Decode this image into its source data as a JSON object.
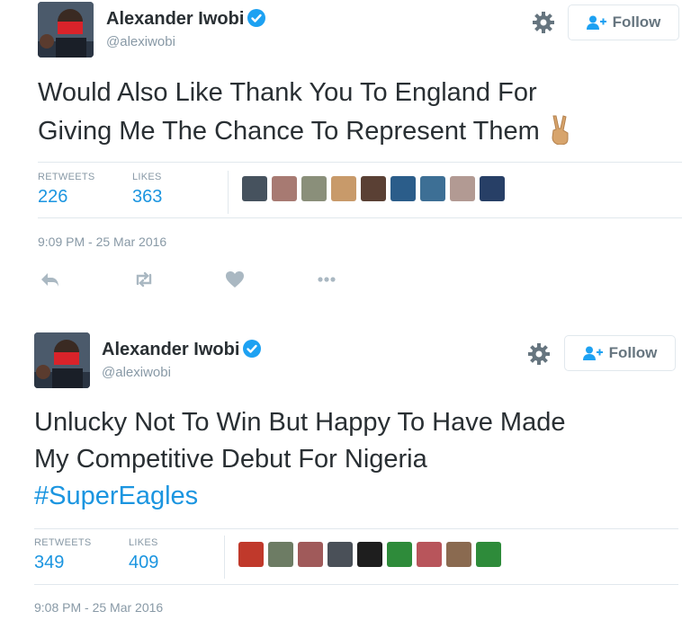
{
  "tweets": [
    {
      "name": "Alexander Iwobi",
      "handle": "@alexiwobi",
      "follow_label": "Follow",
      "text_lines": [
        "Would Also Like Thank You To England For",
        "Giving Me The Chance To Represent Them"
      ],
      "emoji": "victory-hand",
      "retweets_label": "RETWEETS",
      "retweets": "226",
      "likes_label": "LIKES",
      "likes": "363",
      "timestamp": "9:09 PM - 25 Mar 2016",
      "liker_colors": [
        "#46525e",
        "#a77a72",
        "#8a8f7a",
        "#c89a6a",
        "#5a4034",
        "#2b5d8a",
        "#3d6f95",
        "#b29a93",
        "#273f66"
      ]
    },
    {
      "name": "Alexander Iwobi",
      "handle": "@alexiwobi",
      "follow_label": "Follow",
      "text_lines": [
        "Unlucky Not To Win But Happy To Have Made",
        "My Competitive Debut For Nigeria"
      ],
      "hashtag": "#SuperEagles",
      "retweets_label": "RETWEETS",
      "retweets": "349",
      "likes_label": "LIKES",
      "likes": "409",
      "timestamp": "9:08 PM - 25 Mar 2016",
      "liker_colors": [
        "#c0392b",
        "#6d7c64",
        "#a05a5a",
        "#4a5058",
        "#1e1e1e",
        "#2e8b3a",
        "#b8555b",
        "#8a6a50",
        "#2e8b3a"
      ]
    }
  ],
  "colors": {
    "accent": "#1b95e0",
    "verified": "#1da1f2",
    "muted": "#8899a6",
    "text": "#292f33"
  }
}
